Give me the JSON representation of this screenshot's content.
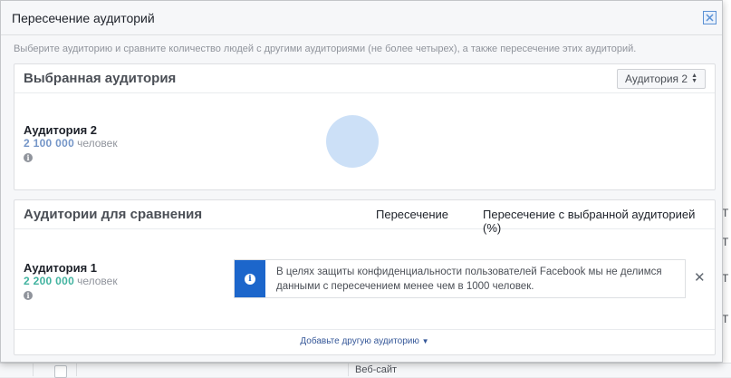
{
  "background": {
    "right_fragments": [
      "Т",
      "Т",
      "Т",
      "Т"
    ],
    "bottom_cell": "Веб-сайт"
  },
  "modal": {
    "title": "Пересечение аудиторий",
    "description": "Выберите аудиторию и сравните количество людей с другими аудиториями (не более четырех), а также пересечение этих аудиторий.",
    "selected_panel": {
      "title": "Выбранная аудитория",
      "selector_value": "Аудитория 2",
      "audience": {
        "name": "Аудитория 2",
        "count": "2 100 000",
        "unit": "человек",
        "color": "#7596c8",
        "circle_color": "#cce0f7"
      }
    },
    "compare_panel": {
      "title": "Аудитории для сравнения",
      "col_overlap": "Пересечение",
      "col_overlap_pct": "Пересечение с выбранной аудиторией (%)",
      "audience": {
        "name": "Аудитория 1",
        "count": "2 200 000",
        "unit": "человек",
        "color": "#42b3a0"
      },
      "notice_line1": "В целях защиты конфиденциальности пользователей Facebook мы не делимся",
      "notice_line2": "данными с пересечением менее чем в 1000 человек.",
      "add_link": "Добавьте другую аудиторию"
    }
  }
}
